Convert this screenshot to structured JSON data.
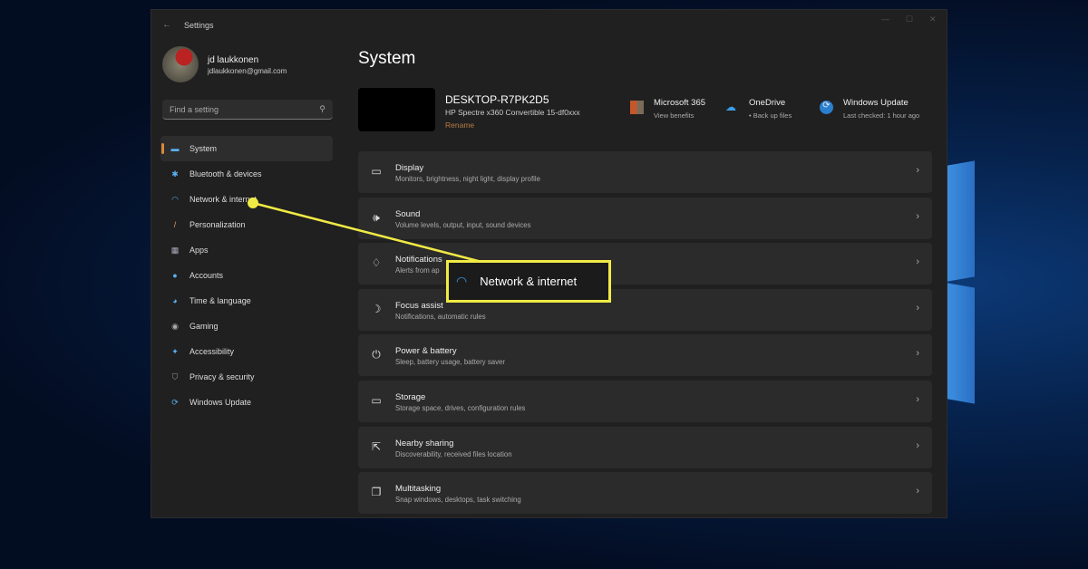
{
  "window": {
    "title": "Settings",
    "back_icon": "arrow-left-icon"
  },
  "user": {
    "name": "jd laukkonen",
    "email": "jdlaukkonen@gmail.com"
  },
  "search": {
    "placeholder": "Find a setting"
  },
  "sidebar": {
    "items": [
      {
        "label": "System",
        "icon": "monitor-icon",
        "selected": true
      },
      {
        "label": "Bluetooth & devices",
        "icon": "bluetooth-icon"
      },
      {
        "label": "Network & internet",
        "icon": "wifi-icon"
      },
      {
        "label": "Personalization",
        "icon": "brush-icon"
      },
      {
        "label": "Apps",
        "icon": "apps-icon"
      },
      {
        "label": "Accounts",
        "icon": "person-icon"
      },
      {
        "label": "Time & language",
        "icon": "globe-clock-icon"
      },
      {
        "label": "Gaming",
        "icon": "gamepad-icon"
      },
      {
        "label": "Accessibility",
        "icon": "accessibility-icon"
      },
      {
        "label": "Privacy & security",
        "icon": "shield-icon"
      },
      {
        "label": "Windows Update",
        "icon": "update-icon"
      }
    ]
  },
  "main": {
    "title": "System",
    "device": {
      "name": "DESKTOP-R7PK2D5",
      "model": "HP Spectre x360 Convertible 15-df0xxx",
      "rename": "Rename"
    },
    "quick": [
      {
        "title": "Microsoft 365",
        "sub": "View benefits"
      },
      {
        "title": "OneDrive",
        "sub": "• Back up files"
      },
      {
        "title": "Windows Update",
        "sub": "Last checked: 1 hour ago"
      }
    ],
    "cards": [
      {
        "title": "Display",
        "sub": "Monitors, brightness, night light, display profile",
        "icon": "display-icon"
      },
      {
        "title": "Sound",
        "sub": "Volume levels, output, input, sound devices",
        "icon": "speaker-icon"
      },
      {
        "title": "Notifications",
        "sub": "Alerts from ap",
        "icon": "bell-icon"
      },
      {
        "title": "Focus assist",
        "sub": "Notifications, automatic rules",
        "icon": "moon-icon"
      },
      {
        "title": "Power & battery",
        "sub": "Sleep, battery usage, battery saver",
        "icon": "power-icon"
      },
      {
        "title": "Storage",
        "sub": "Storage space, drives, configuration rules",
        "icon": "storage-icon"
      },
      {
        "title": "Nearby sharing",
        "sub": "Discoverability, received files location",
        "icon": "share-icon"
      },
      {
        "title": "Multitasking",
        "sub": "Snap windows, desktops, task switching",
        "icon": "multitask-icon"
      }
    ]
  },
  "callout": {
    "label": "Network & internet",
    "color": "#f0ea45"
  },
  "accent": "#d88a3a"
}
